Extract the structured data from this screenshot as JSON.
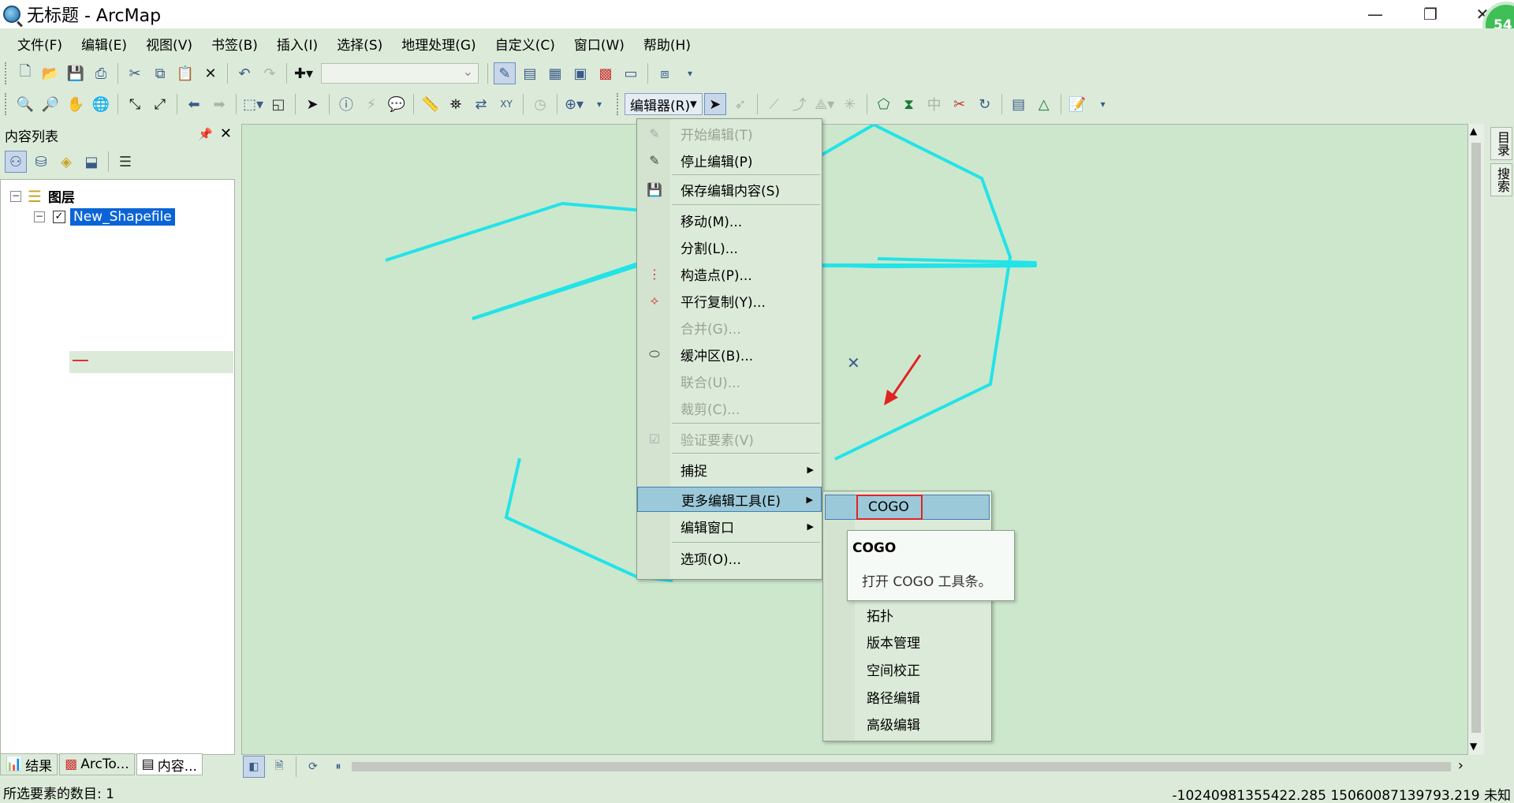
{
  "window": {
    "title": "无标题 - ArcMap",
    "badge": "54"
  },
  "menubar": {
    "items": [
      "文件(F)",
      "编辑(E)",
      "视图(V)",
      "书签(B)",
      "插入(I)",
      "选择(S)",
      "地理处理(G)",
      "自定义(C)",
      "窗口(W)",
      "帮助(H)"
    ]
  },
  "toolbar": {
    "scale_value": "",
    "editor_label": "编辑器(R)"
  },
  "toc": {
    "title": "内容列表",
    "root_label": "图层",
    "layer_name": "New_Shapefile",
    "tabs": [
      "结果",
      "ArcTo...",
      "内容..."
    ]
  },
  "right_strip": {
    "tabs": [
      "目录",
      "搜索"
    ]
  },
  "editor_menu": {
    "items": [
      {
        "label": "开始编辑(T)",
        "enabled": false,
        "icon": "pencil-icon"
      },
      {
        "label": "停止编辑(P)",
        "enabled": true,
        "icon": "stop-edit-icon"
      },
      {
        "label": "保存编辑内容(S)",
        "enabled": true,
        "icon": "save-edits-icon"
      },
      {
        "label": "移动(M)...",
        "enabled": true,
        "icon": ""
      },
      {
        "label": "分割(L)...",
        "enabled": true,
        "icon": ""
      },
      {
        "label": "构造点(P)...",
        "enabled": true,
        "icon": "construct-points-icon"
      },
      {
        "label": "平行复制(Y)...",
        "enabled": true,
        "icon": "copy-parallel-icon"
      },
      {
        "label": "合并(G)...",
        "enabled": false,
        "icon": ""
      },
      {
        "label": "缓冲区(B)...",
        "enabled": true,
        "icon": "buffer-icon"
      },
      {
        "label": "联合(U)...",
        "enabled": false,
        "icon": ""
      },
      {
        "label": "裁剪(C)...",
        "enabled": false,
        "icon": ""
      },
      {
        "label": "验证要素(V)",
        "enabled": false,
        "icon": "validate-icon"
      },
      {
        "label": "捕捉",
        "enabled": true,
        "icon": ""
      },
      {
        "label": "更多编辑工具(E)",
        "enabled": true,
        "icon": ""
      },
      {
        "label": "编辑窗口",
        "enabled": true,
        "icon": ""
      },
      {
        "label": "选项(O)...",
        "enabled": true,
        "icon": ""
      }
    ]
  },
  "sub_menu": {
    "items": [
      "COGO",
      "拓扑",
      "版本管理",
      "空间校正",
      "路径编辑",
      "高级编辑"
    ]
  },
  "tooltip": {
    "title": "COGO",
    "body": "打开 COGO 工具条。"
  },
  "status": {
    "selected_count": "所选要素的数目: 1",
    "coordinates": "-10240981355422.285  15060087139793.219 未知"
  },
  "colors": {
    "polyline": "#22e3e8",
    "highlight": "#9cc9d9",
    "annotation": "#e02424"
  }
}
